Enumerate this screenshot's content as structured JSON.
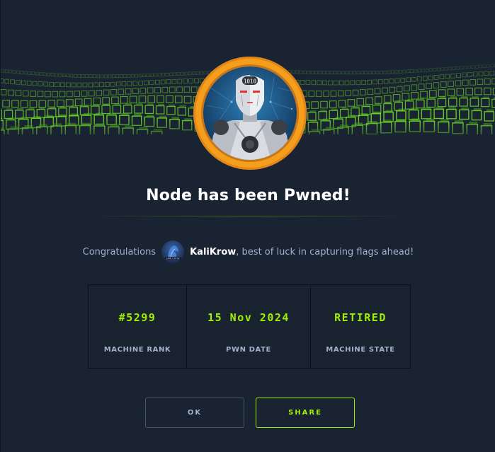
{
  "dialog": {
    "title": "Node has been Pwned!",
    "congrats_prefix": "Congratulations",
    "username": "KaliKrow",
    "congrats_suffix": ", best of luck in capturing flags ahead!"
  },
  "stats": [
    {
      "value": "#5299",
      "label": "MACHINE RANK"
    },
    {
      "value": "15 Nov 2024",
      "label": "PWN DATE"
    },
    {
      "value": "RETIRED",
      "label": "MACHINE STATE"
    }
  ],
  "buttons": {
    "ok": "OK",
    "share": "SHARE"
  },
  "badge": {
    "head_text": "1010"
  },
  "colors": {
    "accent": "#9fef00",
    "background": "#1a2332",
    "badge_ring": "#f59e1c",
    "text_muted": "#a4b1cd"
  },
  "icons": {
    "banner": "green-cube-wave-banner",
    "badge": "node-machine-robot-badge",
    "avatar": "user-avatar"
  }
}
